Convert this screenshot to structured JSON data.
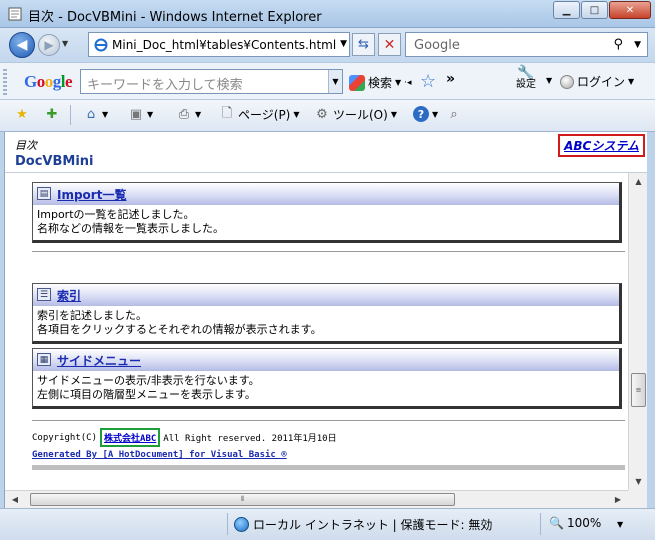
{
  "window": {
    "title": "目次 - DocVBMini - Windows Internet Explorer"
  },
  "address": {
    "url": "Mini_Doc_html¥tables¥Contents.html"
  },
  "search": {
    "placeholder": "Google"
  },
  "google_toolbar": {
    "logo": "Google",
    "search_placeholder": "キーワードを入力して検索",
    "search_button": "検索",
    "more": "»",
    "settings": "設定",
    "login": "ログイン"
  },
  "command_bar": {
    "page": "ページ(P)",
    "tools": "ツール(O)"
  },
  "page": {
    "breadcrumb": "目次",
    "title": "DocVBMini",
    "brand_link": "ABCシステム",
    "sections": [
      {
        "label": "Import一覧",
        "lines": [
          "Importの一覧を記述しました。",
          "名称などの情報を一覧表示しました。"
        ]
      },
      {
        "label": "索引",
        "lines": [
          "索引を記述しました。",
          "各項目をクリックするとそれぞれの情報が表示されます。"
        ]
      },
      {
        "label": "サイドメニュー",
        "lines": [
          "サイドメニューの表示/非表示を行ないます。",
          "左側に項目の階層型メニューを表示します。"
        ]
      }
    ],
    "footer": {
      "copyright_prefix": "Copyright(C)",
      "company": "株式会社ABC",
      "copyright_suffix": "All Right reserved. 2011年1月10日",
      "generated": "Generated By [A HotDocument] for Visual Basic ®"
    }
  },
  "status": {
    "zone": "ローカル イントラネット | 保護モード: 無効",
    "zoom": "100%"
  },
  "colors": {
    "brand_highlight": "#d21a1a",
    "company_highlight": "#1e9e3a",
    "link": "#1a2bb0"
  }
}
